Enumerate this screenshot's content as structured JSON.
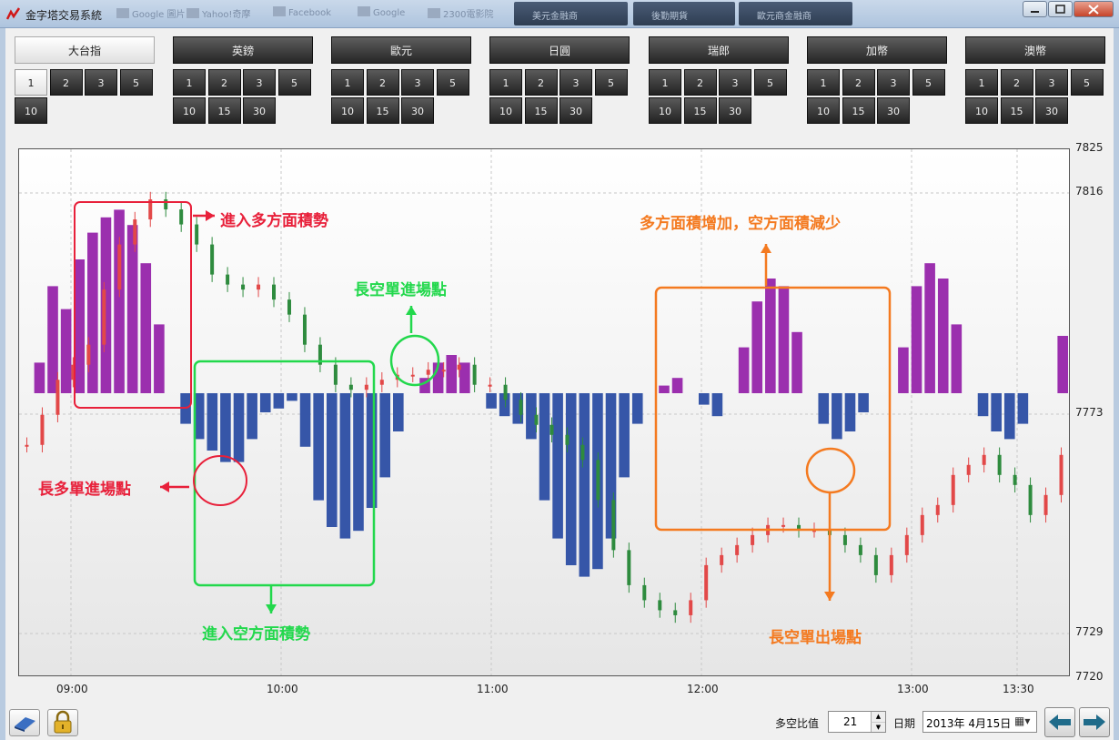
{
  "window": {
    "title": "金字塔交易系統"
  },
  "ghost_tabs": [
    "Google 圖片",
    "Yahoo!奇摩",
    "Facebook",
    "Google",
    "2300電影院"
  ],
  "ghost_buttons": [
    "美元金融商",
    "後勤期貨",
    "歐元商金融商"
  ],
  "groups": [
    {
      "name": "大台指",
      "active": true,
      "periods": [
        "1",
        "2",
        "3",
        "5",
        "10"
      ],
      "selected": "1"
    },
    {
      "name": "英鎊",
      "active": false,
      "periods": [
        "1",
        "2",
        "3",
        "5",
        "10",
        "15",
        "30"
      ],
      "selected": ""
    },
    {
      "name": "歐元",
      "active": false,
      "periods": [
        "1",
        "2",
        "3",
        "5",
        "10",
        "15",
        "30"
      ],
      "selected": ""
    },
    {
      "name": "日圓",
      "active": false,
      "periods": [
        "1",
        "2",
        "3",
        "5",
        "10",
        "15",
        "30"
      ],
      "selected": ""
    },
    {
      "name": "瑞郎",
      "active": false,
      "periods": [
        "1",
        "2",
        "3",
        "5",
        "10",
        "15",
        "30"
      ],
      "selected": ""
    },
    {
      "name": "加幣",
      "active": false,
      "periods": [
        "1",
        "2",
        "3",
        "5",
        "10",
        "15",
        "30"
      ],
      "selected": ""
    },
    {
      "name": "澳幣",
      "active": false,
      "periods": [
        "1",
        "2",
        "3",
        "5",
        "10",
        "15",
        "30"
      ],
      "selected": ""
    }
  ],
  "chart_data": {
    "type": "bar",
    "title": "",
    "y_ticks": [
      7825,
      7816,
      7773,
      7729,
      7720
    ],
    "x_ticks": [
      "09:00",
      "10:00",
      "11:00",
      "12:00",
      "13:00",
      "13:30"
    ],
    "ylim": [
      7720,
      7825
    ],
    "grid": true,
    "series": [
      {
        "name": "",
        "kind": "candlestick",
        "values": [
          7766,
          7772,
          7779,
          7782,
          7786,
          7797,
          7806,
          7811,
          7815,
          7813,
          7810,
          7806,
          7800,
          7798,
          7797,
          7798,
          7795,
          7792,
          7786,
          7782,
          7778,
          7777,
          7778,
          7779,
          7780,
          7780,
          7781,
          7781,
          7782,
          7778,
          7778,
          7775,
          7772,
          7770,
          7768,
          7766,
          7763,
          7755,
          7745,
          7738,
          7735,
          7733,
          7732,
          7735,
          7742,
          7744,
          7746,
          7748,
          7750,
          7750,
          7749,
          7749,
          7748,
          7746,
          7744,
          7740,
          7744,
          7748,
          7752,
          7754,
          7760,
          7762,
          7764,
          7760,
          7758,
          7752,
          7756,
          7764
        ]
      },
      {
        "name": "",
        "kind": "histogram",
        "values": [
          0,
          8,
          28,
          22,
          35,
          42,
          46,
          48,
          44,
          34,
          18,
          0,
          -8,
          -12,
          -15,
          -18,
          -18,
          -12,
          -5,
          -4,
          -2,
          -14,
          -28,
          -35,
          -38,
          -36,
          -30,
          -22,
          -10,
          0,
          4,
          8,
          10,
          8,
          0,
          -4,
          -6,
          -8,
          -12,
          -28,
          -38,
          -45,
          -48,
          -46,
          -38,
          -22,
          -8,
          0,
          2,
          4,
          0,
          -3,
          -6,
          0,
          12,
          24,
          30,
          28,
          16,
          0,
          -8,
          -12,
          -10,
          -5,
          0,
          0,
          12,
          28,
          34,
          30,
          18,
          0,
          -6,
          -10,
          -12,
          -8,
          0,
          0,
          15
        ]
      }
    ],
    "annotations": [
      {
        "text": "進入多方面積勢",
        "color": "#e8203a"
      },
      {
        "text": "長多單進場點",
        "color": "#e8203a"
      },
      {
        "text": "進入空方面積勢",
        "color": "#22d84c"
      },
      {
        "text": "長空單進場點",
        "color": "#22d84c"
      },
      {
        "text": "多方面積增加，空方面積減少",
        "color": "#f47a20"
      },
      {
        "text": "長空單出場點",
        "color": "#f47a20"
      }
    ]
  },
  "bottom": {
    "ratio_label": "多空比值",
    "ratio_value": "21",
    "date_label": "日期",
    "date_value": "2013年  4月15日"
  }
}
